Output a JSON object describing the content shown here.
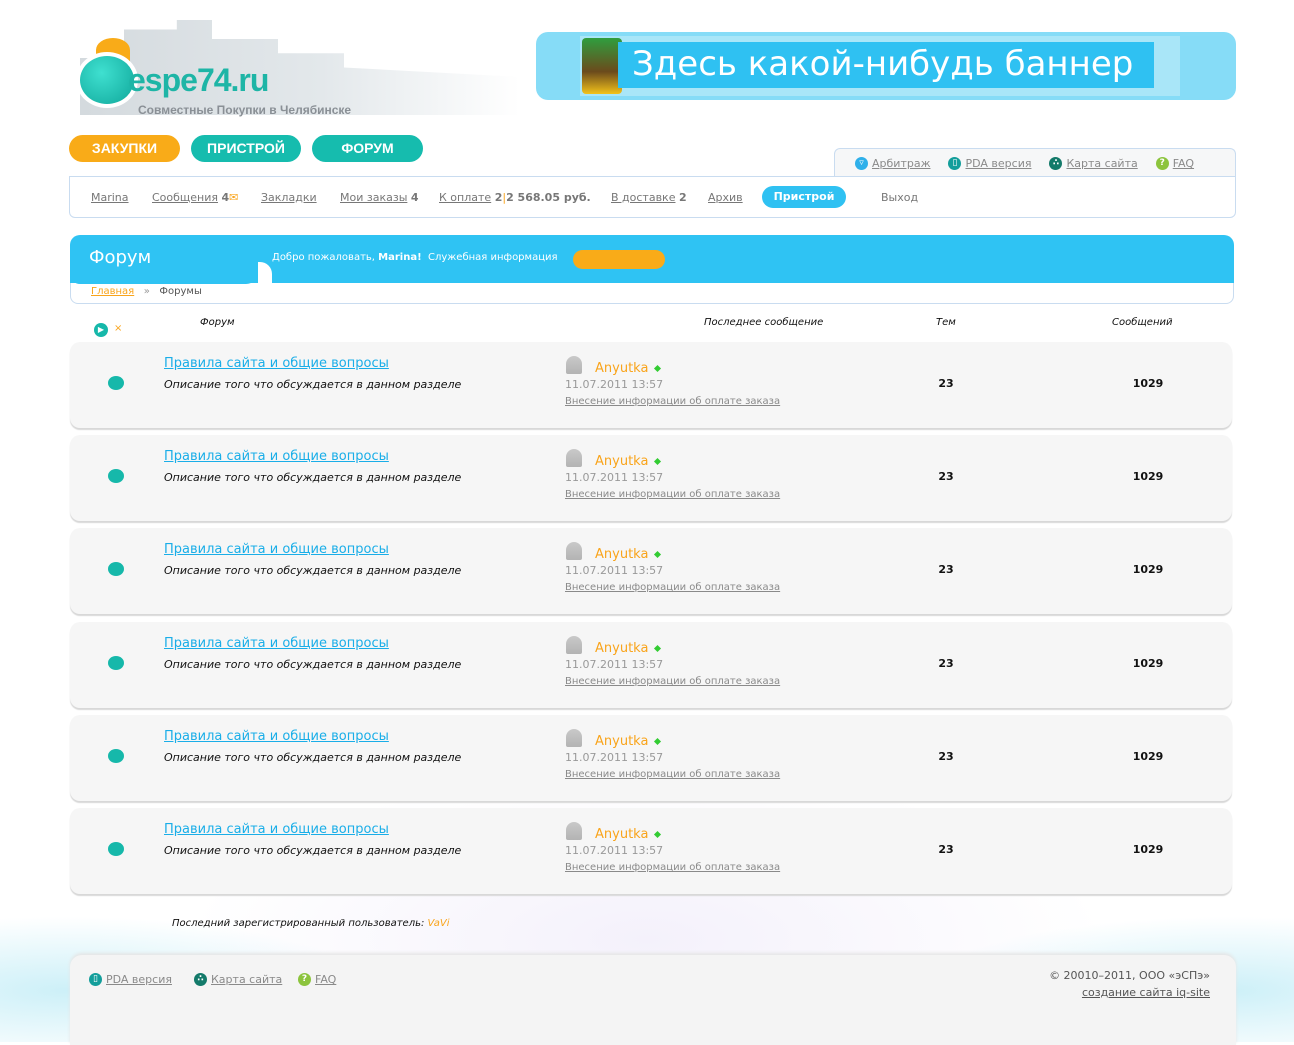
{
  "logo": {
    "text": "espe74.ru",
    "tagline": "Совместные Покупки в Челябинске"
  },
  "banner": {
    "text": "Здесь какой-нибудь баннер"
  },
  "main_nav": [
    {
      "label": "ЗАКУПКИ",
      "color": "#f9ab18"
    },
    {
      "label": "ПРИСТРОЙ",
      "color": "#16bcae"
    },
    {
      "label": "ФОРУМ",
      "color": "#16bcae"
    }
  ],
  "top_links": [
    {
      "label": "Арбитраж",
      "icon": "arbitration-icon"
    },
    {
      "label": "PDA версия",
      "icon": "pda-icon"
    },
    {
      "label": "Карта сайта",
      "icon": "sitemap-icon"
    },
    {
      "label": "FAQ",
      "icon": "faq-icon"
    }
  ],
  "user_bar": {
    "user": "Marina",
    "messages": "Сообщения",
    "messages_count": "4",
    "bookmarks": "Закладки",
    "orders": "Мои заказы",
    "orders_count": "4",
    "to_pay": "К оплате",
    "to_pay_count": "2",
    "to_pay_sum": "2 568.05 руб.",
    "delivery": "В доставке",
    "delivery_count": "2",
    "archive": "Архив",
    "pristroy": "Пристрой",
    "logout": "Выход"
  },
  "forum_header": {
    "title": "Форум",
    "welcome": "Добро пожаловать,",
    "welcome_user": "Marina!",
    "service_info": "Служебная информация"
  },
  "breadcrumb": {
    "home": "Главная",
    "sep": "»",
    "current": "Форумы"
  },
  "columns": {
    "forum": "Форум",
    "last_post": "Последнее сообщение",
    "topics": "Тем",
    "messages": "Сообщений"
  },
  "forums": [
    {
      "title": "Правила сайта и общие вопросы",
      "description": "Описание того что обсуждается в данном разделе",
      "author": "Anyutka",
      "date": "11.07.2011 13:57",
      "post": "Внесение информации об оплате заказа",
      "topics": "23",
      "messages": "1029"
    },
    {
      "title": "Правила сайта и общие вопросы",
      "description": "Описание того что обсуждается в данном разделе",
      "author": "Anyutka",
      "date": "11.07.2011 13:57",
      "post": "Внесение информации об оплате заказа",
      "topics": "23",
      "messages": "1029"
    },
    {
      "title": "Правила сайта и общие вопросы",
      "description": "Описание того что обсуждается в данном разделе",
      "author": "Anyutka",
      "date": "11.07.2011 13:57",
      "post": "Внесение информации об оплате заказа",
      "topics": "23",
      "messages": "1029"
    },
    {
      "title": "Правила сайта и общие вопросы",
      "description": "Описание того что обсуждается в данном разделе",
      "author": "Anyutka",
      "date": "11.07.2011 13:57",
      "post": "Внесение информации об оплате заказа",
      "topics": "23",
      "messages": "1029"
    },
    {
      "title": "Правила сайта и общие вопросы",
      "description": "Описание того что обсуждается в данном разделе",
      "author": "Anyutka",
      "date": "11.07.2011 13:57",
      "post": "Внесение информации об оплате заказа",
      "topics": "23",
      "messages": "1029"
    },
    {
      "title": "Правила сайта и общие вопросы",
      "description": "Описание того что обсуждается в данном разделе",
      "author": "Anyutka",
      "date": "11.07.2011 13:57",
      "post": "Внесение информации об оплате заказа",
      "topics": "23",
      "messages": "1029"
    }
  ],
  "last_user": {
    "label": "Последний зарегистрированный пользователь:",
    "name": "VaVi"
  },
  "footer": {
    "links": [
      {
        "label": "PDA версия"
      },
      {
        "label": "Карта сайта"
      },
      {
        "label": "FAQ"
      }
    ],
    "copyright": "© 20010–2011, ООО «эСПэ»",
    "made_by": "создание сайта  iq-site"
  }
}
